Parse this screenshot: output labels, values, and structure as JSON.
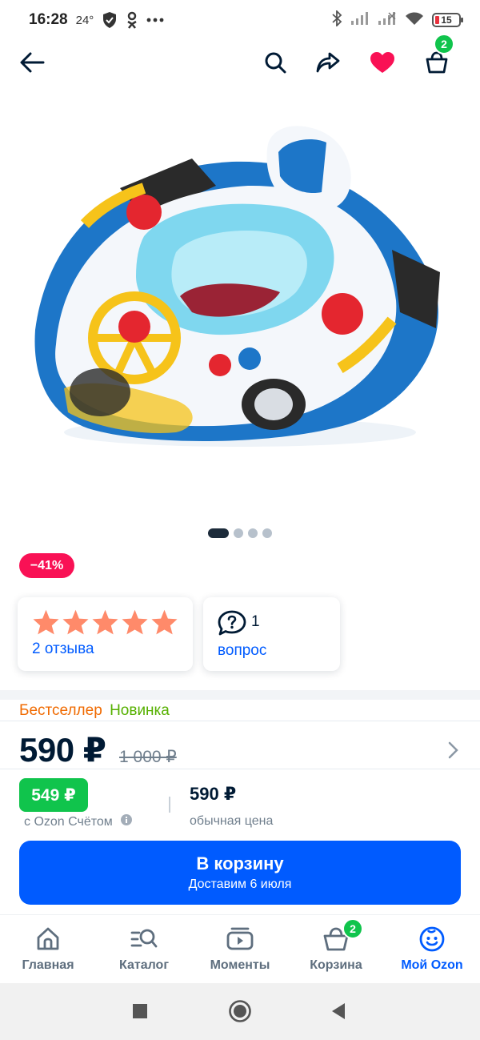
{
  "status_bar": {
    "time": "16:28",
    "temperature": "24°",
    "battery": "15",
    "icons": [
      "shield-icon",
      "ok-icon",
      "more-icon",
      "bluetooth-icon",
      "signal-icon",
      "signal-icon",
      "wifi-icon",
      "battery-icon"
    ]
  },
  "toolbar": {
    "icons": [
      "back-arrow-icon",
      "search-icon",
      "share-icon",
      "heart-icon",
      "cart-icon"
    ],
    "cart_count": "2"
  },
  "carousel": {
    "total": 4,
    "active": 0
  },
  "product": {
    "discount": "−41%",
    "reviews_label": "2 отзыва",
    "rating_stars": 5,
    "questions_count": "1",
    "questions_label": "вопрос",
    "badge_bestseller": "Бестселлер",
    "badge_new": "Новинка",
    "price": "590 ₽",
    "old_price": "1 000 ₽",
    "ozon_price": "549 ₽",
    "ozon_label": "с Ozon Счётом",
    "regular_price": "590 ₽",
    "regular_label": "обычная цена"
  },
  "cart_button": {
    "label": "В корзину",
    "delivery": "Доставим 6 июля"
  },
  "bottom_nav": {
    "items": [
      {
        "label": "Главная",
        "icon": "home-icon"
      },
      {
        "label": "Каталог",
        "icon": "catalog-search-icon"
      },
      {
        "label": "Моменты",
        "icon": "moments-play-icon"
      },
      {
        "label": "Корзина",
        "icon": "cart-icon"
      },
      {
        "label": "Мой Ozon",
        "icon": "face-smile-icon"
      }
    ],
    "cart_count": "2",
    "active_index": 4
  },
  "colors": {
    "accent": "#005bff",
    "discount": "#f91155",
    "green": "#10c44c",
    "bestseller": "#f06a00",
    "new": "#56b000",
    "star": "#ff8a6a"
  }
}
